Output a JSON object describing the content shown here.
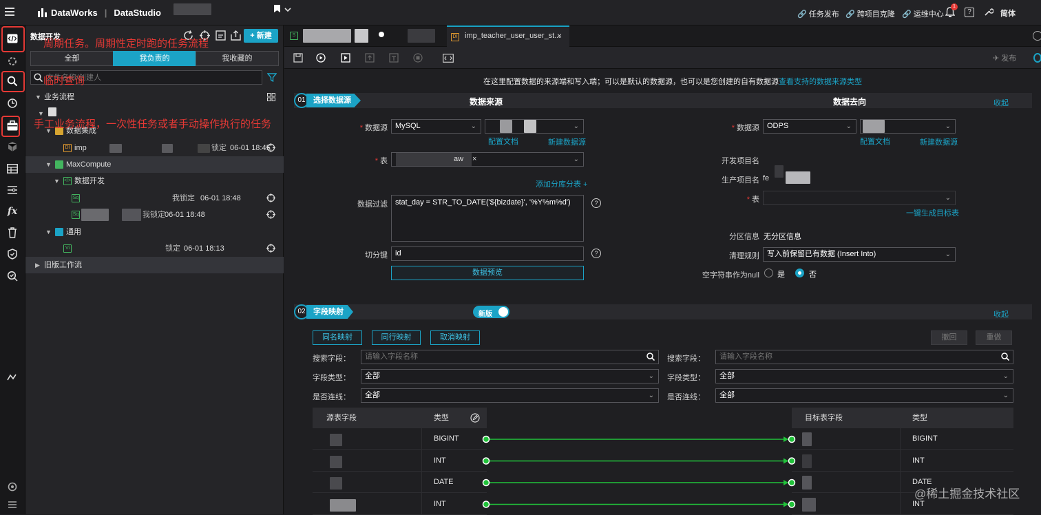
{
  "topbar": {
    "product": "DataWorks",
    "module": "DataStudio",
    "links": [
      "任务发布",
      "跨项目克隆",
      "运维中心"
    ],
    "lang": "简体",
    "notif_count": "1"
  },
  "sidebar": {
    "title": "数据开发",
    "new_button": "+ 新建",
    "filter_tabs": [
      "全部",
      "我负责的",
      "我收藏的"
    ],
    "active_tab": "我负责的",
    "search_placeholder": "文件名称/创建人",
    "tree": {
      "business_flow": "业务流程",
      "data_integration": "数据集成",
      "item1_name": "imp",
      "item1_lock": "锁定",
      "item1_time": "06-01 18:45",
      "maxcompute": "MaxCompute",
      "data_dev": "数据开发",
      "item2_lock": "我锁定",
      "item2_time": "06-01 18:48",
      "item3_lock": "我锁定",
      "item3_time": "06-01 18:48",
      "general": "通用",
      "item4_lock": "锁定",
      "item4_time": "06-01 18:13",
      "legacy": "旧版工作流"
    },
    "annotations": {
      "periodic": "周期任务。周期性定时跑的任务流程",
      "adhoc": "临时查询",
      "manual": "手工业务流程，一次性任务或者手动操作执行的任务"
    }
  },
  "editor": {
    "tab_title": "imp_teacher_user_user_st...",
    "publish": "发布",
    "intro": "在这里配置数据的来源端和写入端；可以是默认的数据源，也可以是您创建的自有数据源",
    "intro_link": "查看支持的数据来源类型",
    "section1": {
      "num": "01",
      "label": "选择数据源",
      "source_title": "数据来源",
      "target_title": "数据去向",
      "collapse": "收起",
      "src": {
        "ds_label": "数据源",
        "ds_type": "MySQL",
        "config_doc": "配置文档",
        "new_ds": "新建数据源",
        "table_label": "表",
        "table_tag_suffix": "aw",
        "add_shard": "添加分库分表 +",
        "filter_label": "数据过滤",
        "filter_value": "stat_day = STR_TO_DATE('${bizdate}', '%Y%m%d')",
        "split_label": "切分键",
        "split_value": "id",
        "preview": "数据预览"
      },
      "dst": {
        "ds_label": "数据源",
        "ds_type": "ODPS",
        "config_doc": "配置文档",
        "new_ds": "新建数据源",
        "dev_project": "开发项目名",
        "prod_project": "生产项目名",
        "prod_prefix": "fe",
        "table_label": "表",
        "gen_table": "一键生成目标表",
        "partition_label": "分区信息",
        "partition_value": "无分区信息",
        "clean_label": "清理规则",
        "clean_value": "写入前保留已有数据 (Insert Into)",
        "null_label": "空字符串作为null",
        "yes": "是",
        "no": "否"
      }
    },
    "section2": {
      "num": "02",
      "label": "字段映射",
      "toggle": "新版",
      "collapse": "收起",
      "buttons": [
        "同名映射",
        "同行映射",
        "取消映射"
      ],
      "undo": "撤回",
      "redo": "重做",
      "search_label": "搜索字段：",
      "search_placeholder": "请输入字段名称",
      "type_label": "字段类型：",
      "type_value": "全部",
      "conn_label": "是否连线：",
      "conn_value": "全部",
      "src_header": "源表字段",
      "type_header": "类型",
      "dst_header": "目标表字段",
      "rows": [
        {
          "src_type": "BIGINT",
          "dst_type": "BIGINT"
        },
        {
          "src_type": "INT",
          "dst_type": "INT"
        },
        {
          "src_type": "DATE",
          "dst_type": "DATE"
        },
        {
          "src_type": "INT",
          "dst_type": "INT"
        }
      ]
    }
  },
  "watermark": "@稀土掘金技术社区",
  "colors": {
    "accent": "#1ba3c6",
    "annotation": "#e53935",
    "link_line": "#21c23a"
  }
}
